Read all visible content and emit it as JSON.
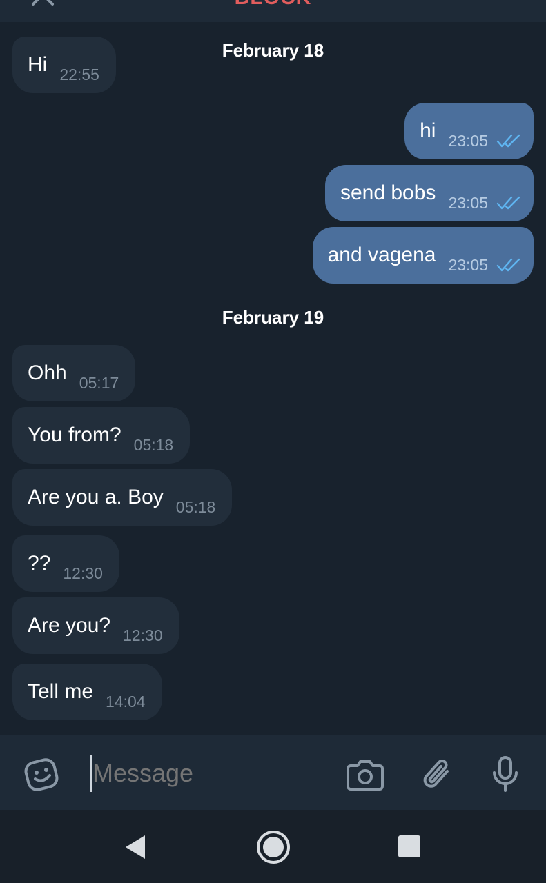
{
  "header": {
    "block_label": "BLOCK"
  },
  "conversation": {
    "dates": [
      "February 18",
      "February 19"
    ],
    "messages": [
      {
        "text": "Hi",
        "time": "22:55",
        "direction": "in"
      },
      {
        "text": "hi",
        "time": "23:05",
        "direction": "out",
        "status": "read"
      },
      {
        "text": "send bobs",
        "time": "23:05",
        "direction": "out",
        "status": "read"
      },
      {
        "text": "and vagena",
        "time": "23:05",
        "direction": "out",
        "status": "read"
      },
      {
        "text": "Ohh",
        "time": "05:17",
        "direction": "in"
      },
      {
        "text": "You from?",
        "time": "05:18",
        "direction": "in"
      },
      {
        "text": "Are you a. Boy",
        "time": "05:18",
        "direction": "in"
      },
      {
        "text": "??",
        "time": "12:30",
        "direction": "in"
      },
      {
        "text": "Are you?",
        "time": "12:30",
        "direction": "in"
      },
      {
        "text": "Tell me",
        "time": "14:04",
        "direction": "in"
      }
    ]
  },
  "composer": {
    "placeholder": "Message",
    "icons": [
      "sticker-emoji-icon",
      "camera-icon",
      "paperclip-icon",
      "microphone-icon"
    ]
  },
  "navbar": {
    "icons": [
      "back-icon",
      "home-icon",
      "recents-icon"
    ]
  },
  "colors": {
    "background": "#18222d",
    "incoming_bubble": "#222e3b",
    "outgoing_bubble": "#4b6f9c",
    "block_red": "#e15d5d",
    "read_ticks": "#5fb5f1"
  }
}
